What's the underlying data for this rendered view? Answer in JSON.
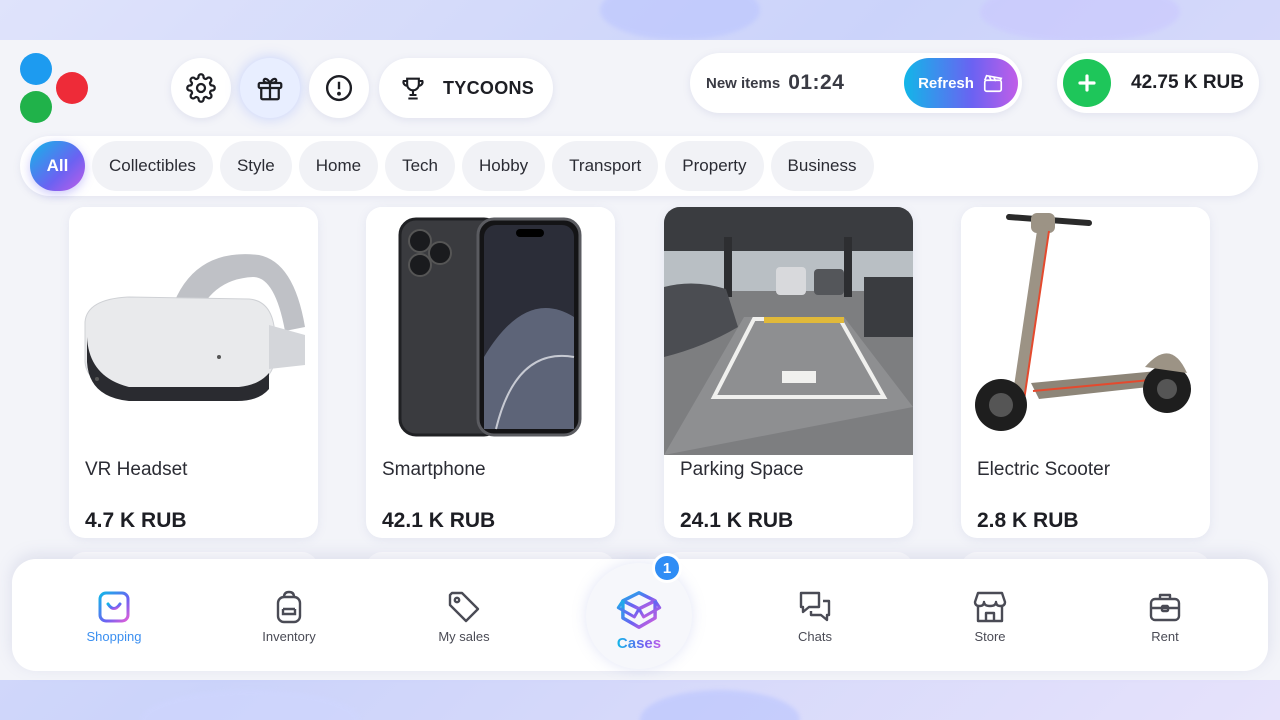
{
  "header": {
    "buttons": [
      {
        "icon": "gear-icon"
      },
      {
        "icon": "gift-icon"
      },
      {
        "icon": "alert-icon"
      }
    ],
    "tycoons_label": "TYCOONS",
    "new_items_label": "New items",
    "new_items_timer": "01:24",
    "refresh_label": "Refresh",
    "balance": "42.75 K RUB"
  },
  "categories": [
    "All",
    "Collectibles",
    "Style",
    "Home",
    "Tech",
    "Hobby",
    "Transport",
    "Property",
    "Business"
  ],
  "selected_category": "All",
  "products": [
    {
      "title": "VR Headset",
      "price": "4.7 K RUB"
    },
    {
      "title": "Smartphone",
      "price": "42.1 K RUB"
    },
    {
      "title": "Parking Space",
      "price": "24.1 K RUB"
    },
    {
      "title": "Electric Scooter",
      "price": "2.8 K RUB"
    }
  ],
  "bottom_nav": {
    "items": [
      {
        "label": "Shopping",
        "icon": "shopping-bag-icon"
      },
      {
        "label": "Inventory",
        "icon": "backpack-icon"
      },
      {
        "label": "My sales",
        "icon": "tag-icon"
      },
      {
        "label": "Cases",
        "icon": "cases-box-icon"
      },
      {
        "label": "Chats",
        "icon": "chat-icon"
      },
      {
        "label": "Store",
        "icon": "store-icon"
      },
      {
        "label": "Rent",
        "icon": "briefcase-icon"
      }
    ],
    "active": "Shopping",
    "cases_badge": "1"
  },
  "colors": {
    "accent_gradient": [
      "#12b6e8",
      "#6b62f2",
      "#c15ee8"
    ],
    "plus_green": "#1ec65a",
    "badge_blue": "#2f8df5"
  }
}
